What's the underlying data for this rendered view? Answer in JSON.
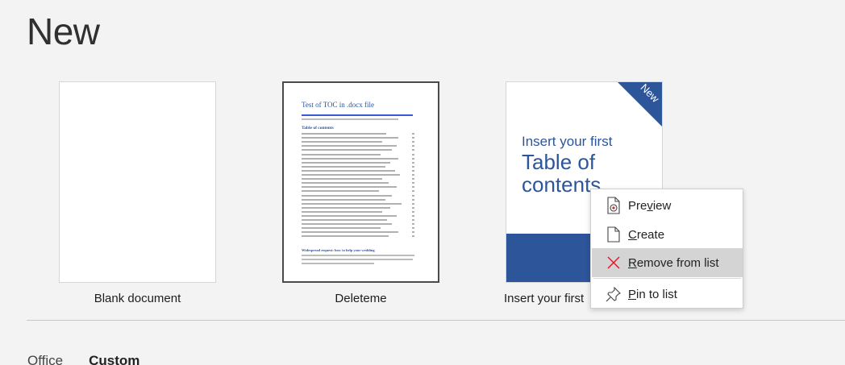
{
  "page": {
    "title": "New"
  },
  "templates": [
    {
      "label": "Blank document"
    },
    {
      "label": "Deleteme",
      "doc_title": "Test of TOC in .docx file",
      "toc_heading": "Table of contents",
      "section_heading": "Widespread request: how to help your wedding"
    },
    {
      "label": "Insert your first",
      "badge": "New",
      "subtitle": "Insert your first",
      "headline": "Table of contents"
    }
  ],
  "tabs": [
    {
      "label": "Office"
    },
    {
      "label": "Custom"
    }
  ],
  "context_menu": {
    "items": [
      {
        "pre": "Pre",
        "accel": "v",
        "post": "iew",
        "icon": "preview-icon"
      },
      {
        "pre": "",
        "accel": "C",
        "post": "reate",
        "icon": "create-document-icon"
      },
      {
        "pre": "",
        "accel": "R",
        "post": "emove from list",
        "icon": "remove-x-icon"
      },
      {
        "pre": "",
        "accel": "P",
        "post": "in to list",
        "icon": "pin-icon"
      }
    ]
  },
  "colors": {
    "accent": "#2c559a",
    "remove_icon": "#e81123",
    "hover": "#d4d4d4"
  }
}
